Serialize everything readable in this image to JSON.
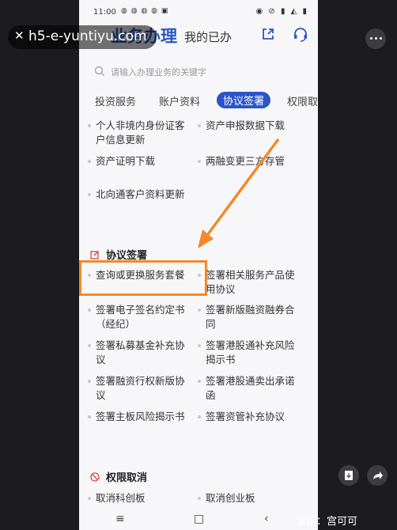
{
  "status": {
    "time": "11:00",
    "apps": "◍ ◍ ◍ ◍ ▣",
    "icons": "◉ ⊘ ▮ ◭ ▮"
  },
  "header": {
    "title": "业务办理",
    "sub": "我的已办"
  },
  "search": {
    "placeholder": "请输入办理业务的关键字"
  },
  "tabs": [
    "投资服务",
    "账户资料",
    "协议签署",
    "权限取"
  ],
  "top_items": [
    {
      "label": "个人非境内身份证客户信息更新"
    },
    {
      "label": "资产申报数据下载"
    },
    {
      "label": "资产证明下载"
    },
    {
      "label": "两融变更三方存管"
    },
    {
      "label": "北向通客户资料更新"
    }
  ],
  "section_sign": {
    "title": "协议签署",
    "items": [
      {
        "label": "查询或更换服务套餐"
      },
      {
        "label": "签署相关服务产品使用协议"
      },
      {
        "label": "签署电子签名约定书（经纪）"
      },
      {
        "label": "签署新版融资融券合同"
      },
      {
        "label": "签署私募基金补充协议"
      },
      {
        "label": "签署港股通补充风险揭示书"
      },
      {
        "label": "签署融资行权新版协议"
      },
      {
        "label": "签署港股通卖出承诺函"
      },
      {
        "label": "签署主板风险揭示书"
      },
      {
        "label": "签署资管补充协议"
      }
    ]
  },
  "section_cancel": {
    "title": "权限取消",
    "items": [
      {
        "label": "取消科创板"
      },
      {
        "label": "取消创业板"
      }
    ]
  },
  "overlay": {
    "watermark": "h5-e-yuntiyu.com",
    "close": "✕",
    "brand": "雪球：宫可可"
  },
  "colors": {
    "accent": "#2b55c8",
    "highlight": "#f08a2c"
  }
}
